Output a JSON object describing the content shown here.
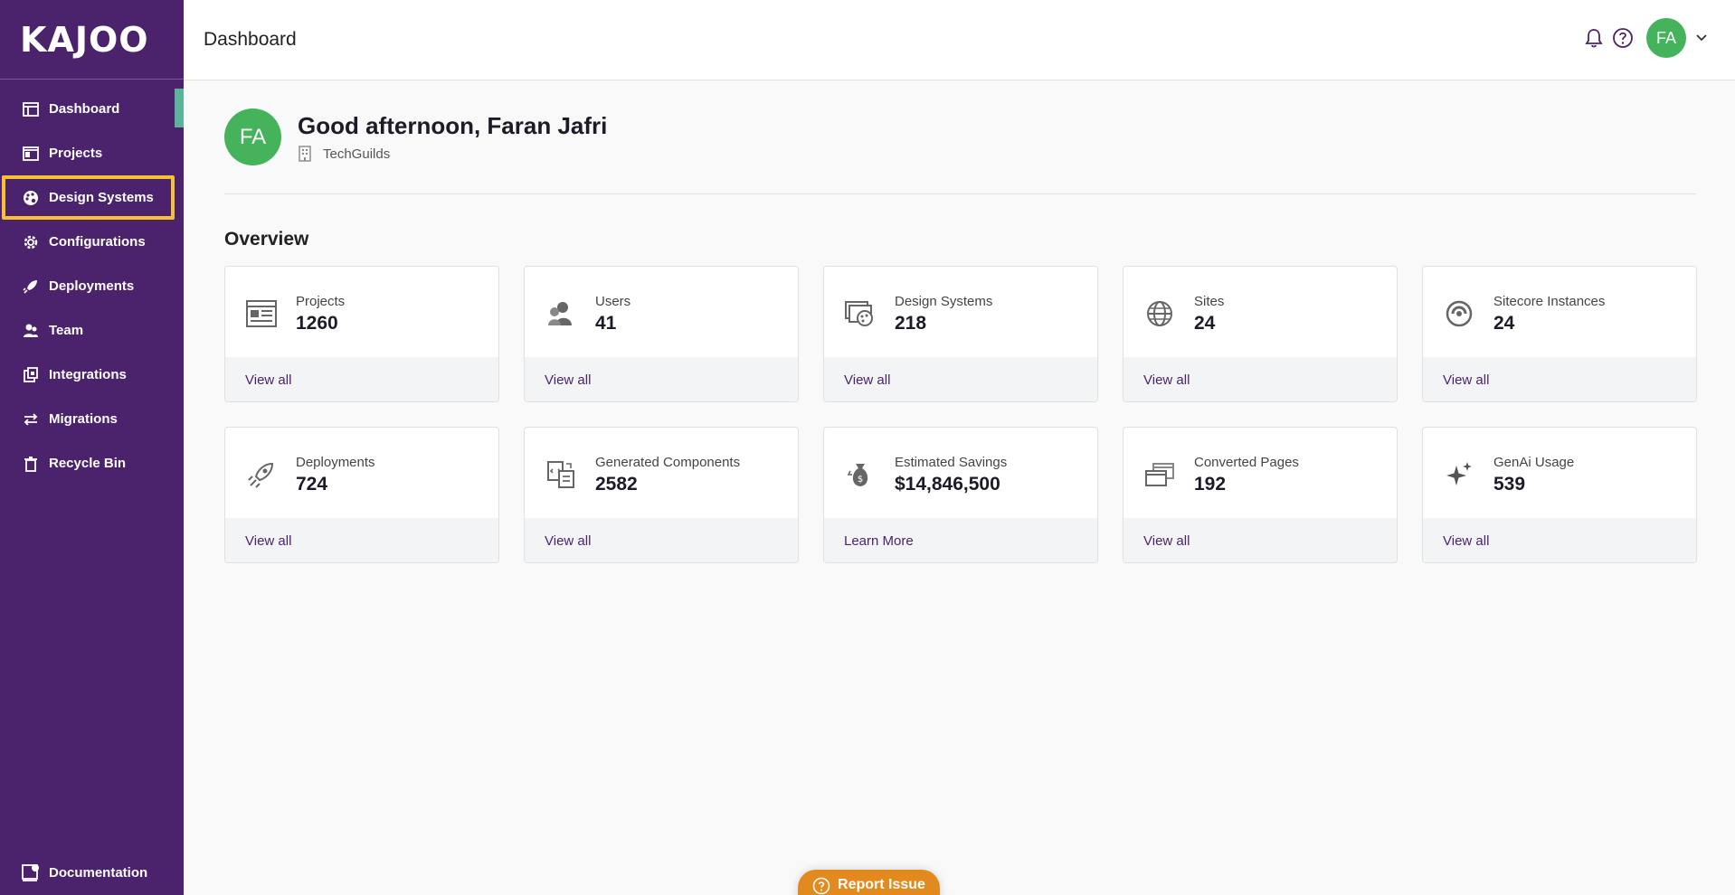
{
  "app": {
    "logo": "KAJOO"
  },
  "sidebar": {
    "items": [
      {
        "label": "Dashboard",
        "icon": "dashboard-icon"
      },
      {
        "label": "Projects",
        "icon": "projects-icon"
      },
      {
        "label": "Design Systems",
        "icon": "palette-icon"
      },
      {
        "label": "Configurations",
        "icon": "gear-icon"
      },
      {
        "label": "Deployments",
        "icon": "rocket-icon"
      },
      {
        "label": "Team",
        "icon": "team-icon"
      },
      {
        "label": "Integrations",
        "icon": "integrations-icon"
      },
      {
        "label": "Migrations",
        "icon": "arrows-icon"
      },
      {
        "label": "Recycle Bin",
        "icon": "trash-icon"
      }
    ],
    "bottom": {
      "label": "Documentation",
      "icon": "documentation-icon"
    },
    "active_index": 0,
    "highlight_index": 2
  },
  "header": {
    "title": "Dashboard",
    "avatar": "FA"
  },
  "greeting": {
    "avatar": "FA",
    "text": "Good afternoon, Faran Jafri",
    "org": "TechGuilds"
  },
  "overview": {
    "title": "Overview",
    "cards": [
      {
        "label": "Projects",
        "value": "1260",
        "link": "View all",
        "icon": "projects-icon"
      },
      {
        "label": "Users",
        "value": "41",
        "link": "View all",
        "icon": "users-icon"
      },
      {
        "label": "Design Systems",
        "value": "218",
        "link": "View all",
        "icon": "design-systems-icon"
      },
      {
        "label": "Sites",
        "value": "24",
        "link": "View all",
        "icon": "globe-icon"
      },
      {
        "label": "Sitecore Instances",
        "value": "24",
        "link": "View all",
        "icon": "sitecore-icon"
      },
      {
        "label": "Deployments",
        "value": "724",
        "link": "View all",
        "icon": "rocket-icon"
      },
      {
        "label": "Generated Components",
        "value": "2582",
        "link": "View all",
        "icon": "code-file-icon"
      },
      {
        "label": "Estimated Savings",
        "value": "$14,846,500",
        "link": "Learn More",
        "icon": "money-bag-icon"
      },
      {
        "label": "Converted Pages",
        "value": "192",
        "link": "View all",
        "icon": "pages-icon"
      },
      {
        "label": "GenAi Usage",
        "value": "539",
        "link": "View all",
        "icon": "sparkle-icon"
      }
    ]
  },
  "report": {
    "label": "Report Issue"
  },
  "colors": {
    "sidebar": "#4b236d",
    "accent": "#5bb39a",
    "highlight": "#f5c233",
    "avatar": "#45b35c",
    "report": "#e28a1e"
  }
}
